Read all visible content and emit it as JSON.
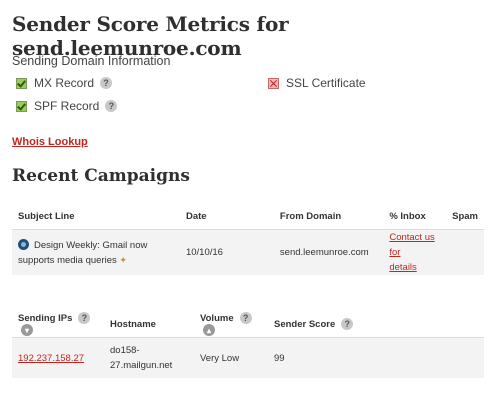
{
  "page": {
    "title": "Sender Score Metrics for send.leemunroe.com"
  },
  "domain_info": {
    "label": "Sending Domain Information",
    "checks": [
      {
        "label": "MX Record",
        "status": "pass",
        "help": "?"
      },
      {
        "label": "SPF Record",
        "status": "pass",
        "help": "?"
      },
      {
        "label": "SSL Certificate",
        "status": "fail"
      }
    ]
  },
  "whois": {
    "label": "Whois Lookup"
  },
  "campaigns": {
    "heading": "Recent Campaigns",
    "columns": [
      "Subject Line",
      "Date",
      "From Domain",
      "% Inbox",
      "Spam"
    ],
    "rows": [
      {
        "subject_line1": "Design Weekly: Gmail now",
        "subject_line2": "supports media queries",
        "date": "10/10/16",
        "from_domain": "send.leemunroe.com",
        "inbox_link_line1": "Contact us for",
        "inbox_link_line2": "details",
        "spam": ""
      }
    ]
  },
  "ips": {
    "columns": [
      "Sending IPs",
      "Hostname",
      "Volume",
      "Sender Score"
    ],
    "help": "?",
    "rows": [
      {
        "ip": "192.237.158.27",
        "hostname_line1": "do158-",
        "hostname_line2": "27.mailgun.net",
        "volume": "Very Low",
        "score": "99"
      }
    ]
  }
}
